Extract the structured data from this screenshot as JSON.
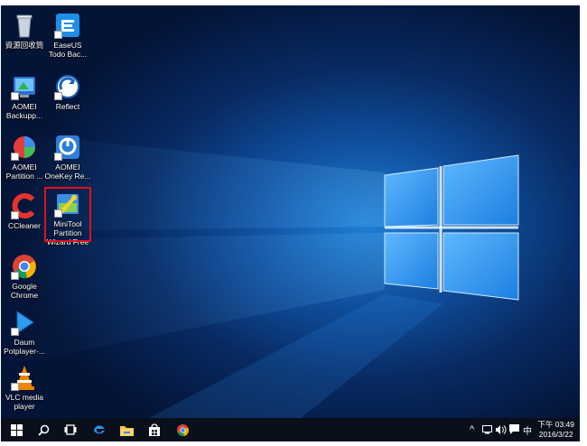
{
  "desktop": {
    "icons": [
      {
        "label": "資源回收筒",
        "icon": "recycle-bin-icon"
      },
      {
        "label": "EaseUS\nTodo Bac...",
        "icon": "easeus-todo-backup-icon"
      },
      {
        "label": "AOMEI\nBackupp...",
        "icon": "aomei-backupper-icon"
      },
      {
        "label": "Reflect",
        "icon": "macrium-reflect-icon"
      },
      {
        "label": "AOMEI\nPartition ...",
        "icon": "aomei-partition-icon"
      },
      {
        "label": "AOMEI\nOneKey Re...",
        "icon": "aomei-onekey-icon"
      },
      {
        "label": "CCleaner",
        "icon": "ccleaner-icon"
      },
      {
        "label": "MiniTool\nPartition\nWizard Free",
        "icon": "minitool-partition-wizard-icon"
      },
      {
        "label": "Google\nChrome",
        "icon": "chrome-icon"
      },
      {
        "label": "Daum\nPotplayer-...",
        "icon": "potplayer-icon"
      },
      {
        "label": "VLC media\nplayer",
        "icon": "vlc-icon"
      }
    ]
  },
  "taskbar": {
    "buttons": [
      "windows-start-icon",
      "search-icon",
      "task-view-icon",
      "edge-icon",
      "file-explorer-icon",
      "store-icon",
      "chrome-icon"
    ],
    "tray": {
      "chevron": "^",
      "ime": "中"
    },
    "clock": {
      "time": "下午 03:49",
      "date": "2016/3/22"
    }
  },
  "colors": {
    "highlight_border": "#e0101b",
    "taskbar": "#0a0f1c"
  }
}
